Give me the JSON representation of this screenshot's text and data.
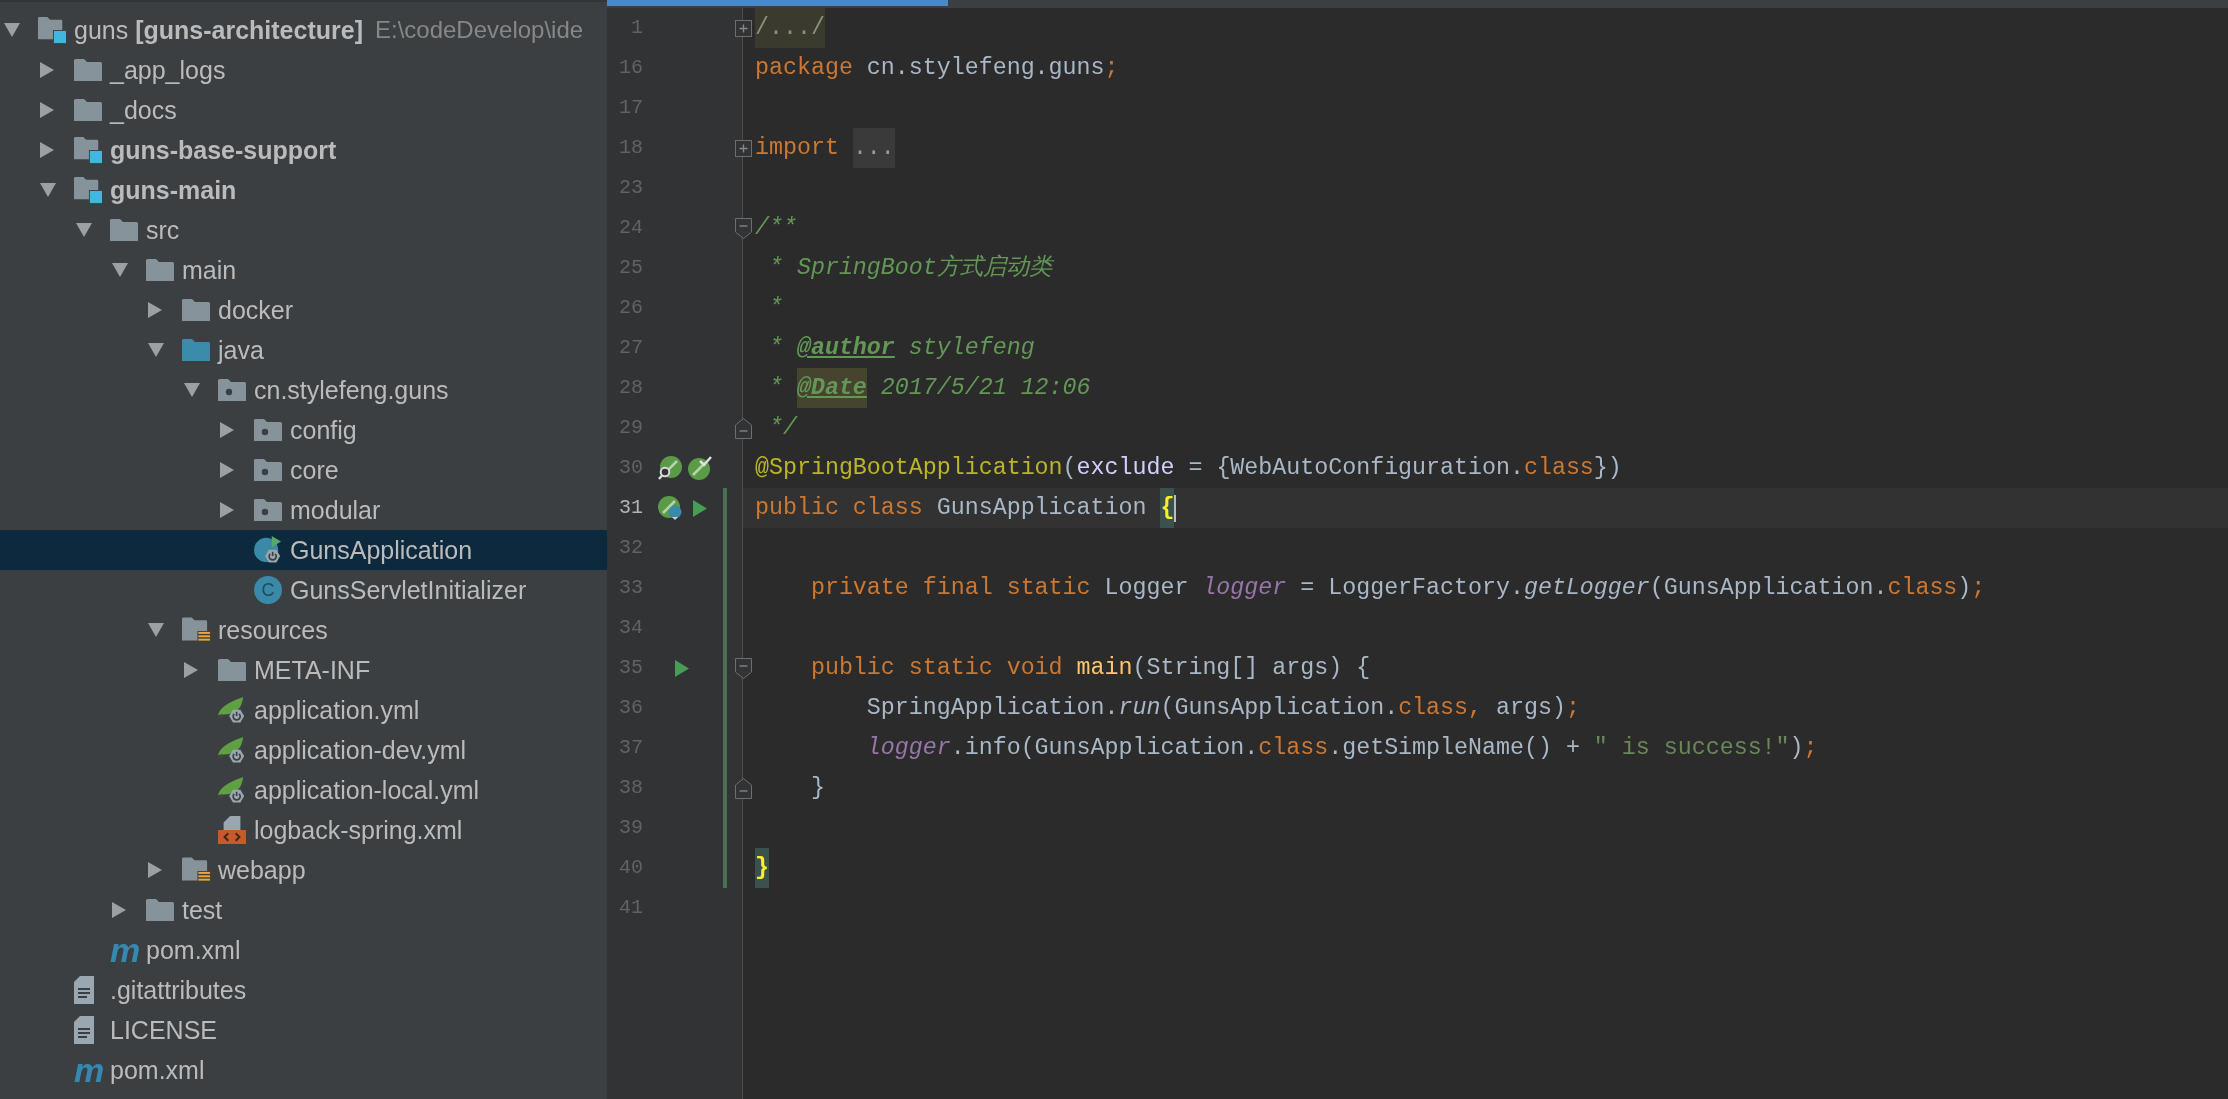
{
  "project_tree": {
    "items": [
      {
        "label": "guns **[guns-architecture]**",
        "path": "E:\\codeDevelop\\ide",
        "kind": "project",
        "expanded": true,
        "selected": false,
        "children": [
          {
            "label": "_app_logs",
            "kind": "folder",
            "expanded": false,
            "selected": false
          },
          {
            "label": "_docs",
            "kind": "folder",
            "expanded": false,
            "selected": false
          },
          {
            "label": "guns-base-support",
            "kind": "module",
            "expanded": false,
            "selected": false
          },
          {
            "label": "guns-main",
            "kind": "module",
            "expanded": true,
            "selected": false,
            "children": [
              {
                "label": "src",
                "kind": "folder",
                "expanded": true,
                "selected": false,
                "children": [
                  {
                    "label": "main",
                    "kind": "folder",
                    "expanded": true,
                    "selected": false,
                    "children": [
                      {
                        "label": "docker",
                        "kind": "folder",
                        "expanded": false,
                        "selected": false
                      },
                      {
                        "label": "java",
                        "kind": "source",
                        "expanded": true,
                        "selected": false,
                        "children": [
                          {
                            "label": "cn.stylefeng.guns",
                            "kind": "package",
                            "expanded": true,
                            "selected": false,
                            "children": [
                              {
                                "label": "config",
                                "kind": "package",
                                "expanded": false,
                                "selected": false
                              },
                              {
                                "label": "core",
                                "kind": "package",
                                "expanded": false,
                                "selected": false
                              },
                              {
                                "label": "modular",
                                "kind": "package",
                                "expanded": false,
                                "selected": false
                              },
                              {
                                "label": "GunsApplication",
                                "kind": "springclass",
                                "selected": true
                              },
                              {
                                "label": "GunsServletInitializer",
                                "kind": "class",
                                "glyph": "C",
                                "selected": false
                              }
                            ]
                          }
                        ]
                      },
                      {
                        "label": "resources",
                        "kind": "resources",
                        "expanded": true,
                        "selected": false,
                        "children": [
                          {
                            "label": "META-INF",
                            "kind": "folder",
                            "expanded": false,
                            "selected": false
                          },
                          {
                            "label": "application.yml",
                            "kind": "springconfig",
                            "selected": false
                          },
                          {
                            "label": "application-dev.yml",
                            "kind": "springconfig",
                            "selected": false
                          },
                          {
                            "label": "application-local.yml",
                            "kind": "springconfig",
                            "selected": false
                          },
                          {
                            "label": "logback-spring.xml",
                            "kind": "xml",
                            "selected": false
                          }
                        ]
                      },
                      {
                        "label": "webapp",
                        "kind": "resources",
                        "expanded": false,
                        "selected": false
                      }
                    ]
                  },
                  {
                    "label": "test",
                    "kind": "folder",
                    "expanded": false,
                    "selected": false
                  }
                ]
              },
              {
                "label": "pom.xml",
                "kind": "maven",
                "glyph": "m",
                "selected": false
              }
            ]
          },
          {
            "label": ".gitattributes",
            "kind": "text",
            "selected": false
          },
          {
            "label": "LICENSE",
            "kind": "text",
            "selected": false
          },
          {
            "label": "pom.xml",
            "kind": "maven",
            "glyph": "m",
            "selected": false
          }
        ]
      }
    ]
  },
  "editor": {
    "lines": [
      {
        "number": "1",
        "fold": {
          "kind": "collapsed"
        },
        "current": false,
        "changed": false,
        "tokens": [
          {
            "text": "/.../",
            "kind": "folded"
          }
        ]
      },
      {
        "number": "16",
        "current": false,
        "changed": false,
        "tokens": [
          {
            "text": "package ",
            "kind": "keyword"
          },
          {
            "text": "cn.stylefeng.guns",
            "kind": "plain"
          },
          {
            "text": ";",
            "kind": "keyword"
          }
        ]
      },
      {
        "number": "17",
        "current": false,
        "changed": false
      },
      {
        "number": "18",
        "fold": {
          "kind": "collapsed"
        },
        "current": false,
        "changed": false,
        "tokens": [
          {
            "text": "import ",
            "kind": "keyword"
          },
          {
            "text": "...",
            "kind": "placeholder"
          }
        ]
      },
      {
        "number": "23",
        "current": false,
        "changed": false
      },
      {
        "number": "24",
        "fold": {
          "kind": "start"
        },
        "current": false,
        "changed": false,
        "tokens": [
          {
            "text": "/**",
            "kind": "comment"
          }
        ]
      },
      {
        "number": "25",
        "current": false,
        "changed": false,
        "tokens": [
          {
            "text": " * SpringBoot方式启动类",
            "kind": "comment"
          }
        ]
      },
      {
        "number": "26",
        "current": false,
        "changed": false,
        "tokens": [
          {
            "text": " *",
            "kind": "comment"
          }
        ]
      },
      {
        "number": "27",
        "current": false,
        "changed": false,
        "tokens": [
          {
            "text": " * ",
            "kind": "comment"
          },
          {
            "text": "@author",
            "kind": "doctag",
            "highlighted": false
          },
          {
            "text": " stylefeng",
            "kind": "comment"
          }
        ]
      },
      {
        "number": "28",
        "current": false,
        "changed": false,
        "tokens": [
          {
            "text": " * ",
            "kind": "comment"
          },
          {
            "text": "@Date",
            "kind": "doctag",
            "highlighted": true
          },
          {
            "text": " 2017/5/21 12:06",
            "kind": "comment"
          }
        ]
      },
      {
        "number": "29",
        "fold": {
          "kind": "end"
        },
        "current": false,
        "changed": false,
        "tokens": [
          {
            "text": " */",
            "kind": "comment"
          }
        ]
      },
      {
        "number": "30",
        "current": false,
        "changed": false,
        "gutter": [
          {
            "kind": "leafsearch"
          },
          {
            "kind": "leafcheck"
          }
        ],
        "tokens": [
          {
            "text": "@SpringBootApplication",
            "kind": "annotation"
          },
          {
            "text": "(",
            "kind": "plain"
          },
          {
            "text": "exclude",
            "kind": "attribute"
          },
          {
            "text": " = {WebAutoConfiguration.",
            "kind": "plain"
          },
          {
            "text": "class",
            "kind": "keyword"
          },
          {
            "text": "})",
            "kind": "plain"
          }
        ]
      },
      {
        "number": "31",
        "current": true,
        "changed": true,
        "gutter": [
          {
            "kind": "leafclass"
          },
          {
            "kind": "run"
          }
        ],
        "tokens": [
          {
            "text": "public class ",
            "kind": "keyword"
          },
          {
            "text": "GunsApplication ",
            "kind": "plain"
          },
          {
            "text": "{",
            "kind": "brace"
          }
        ]
      },
      {
        "number": "32",
        "current": false,
        "changed": true
      },
      {
        "number": "33",
        "current": false,
        "changed": true,
        "tokens": [
          {
            "text": "    private final static ",
            "kind": "keyword"
          },
          {
            "text": "Logger ",
            "kind": "plain"
          },
          {
            "text": "logger",
            "kind": "field"
          },
          {
            "text": " = LoggerFactory.",
            "kind": "plain"
          },
          {
            "text": "getLogger",
            "kind": "call"
          },
          {
            "text": "(GunsApplication.",
            "kind": "plain"
          },
          {
            "text": "class",
            "kind": "keyword"
          },
          {
            "text": ")",
            "kind": "plain"
          },
          {
            "text": ";",
            "kind": "keyword"
          }
        ]
      },
      {
        "number": "34",
        "current": false,
        "changed": true
      },
      {
        "number": "35",
        "fold": {
          "kind": "start"
        },
        "current": false,
        "changed": true,
        "gutter": [
          {
            "kind": "run"
          }
        ],
        "tokens": [
          {
            "text": "    public static void ",
            "kind": "keyword"
          },
          {
            "text": "main",
            "kind": "method"
          },
          {
            "text": "(String[] args) {",
            "kind": "plain"
          }
        ]
      },
      {
        "number": "36",
        "current": false,
        "changed": true,
        "tokens": [
          {
            "text": "        SpringApplication.",
            "kind": "plain"
          },
          {
            "text": "run",
            "kind": "call"
          },
          {
            "text": "(GunsApplication.",
            "kind": "plain"
          },
          {
            "text": "class,",
            "kind": "keyword"
          },
          {
            "text": " args)",
            "kind": "plain"
          },
          {
            "text": ";",
            "kind": "keyword"
          }
        ]
      },
      {
        "number": "37",
        "current": false,
        "changed": true,
        "tokens": [
          {
            "text": "        logger",
            "kind": "field"
          },
          {
            "text": ".info(GunsApplication.",
            "kind": "plain"
          },
          {
            "text": "class",
            "kind": "keyword"
          },
          {
            "text": ".getSimpleName() + ",
            "kind": "plain"
          },
          {
            "text": "\" is success!\"",
            "kind": "string"
          },
          {
            "text": ")",
            "kind": "plain"
          },
          {
            "text": ";",
            "kind": "keyword"
          }
        ]
      },
      {
        "number": "38",
        "fold": {
          "kind": "end"
        },
        "current": false,
        "changed": true,
        "tokens": [
          {
            "text": "    }",
            "kind": "plain"
          }
        ]
      },
      {
        "number": "39",
        "current": false,
        "changed": true
      },
      {
        "number": "40",
        "current": false,
        "changed": true,
        "tokens": [
          {
            "text": "}",
            "kind": "brace"
          }
        ]
      },
      {
        "number": "41",
        "current": false,
        "changed": false
      }
    ]
  }
}
